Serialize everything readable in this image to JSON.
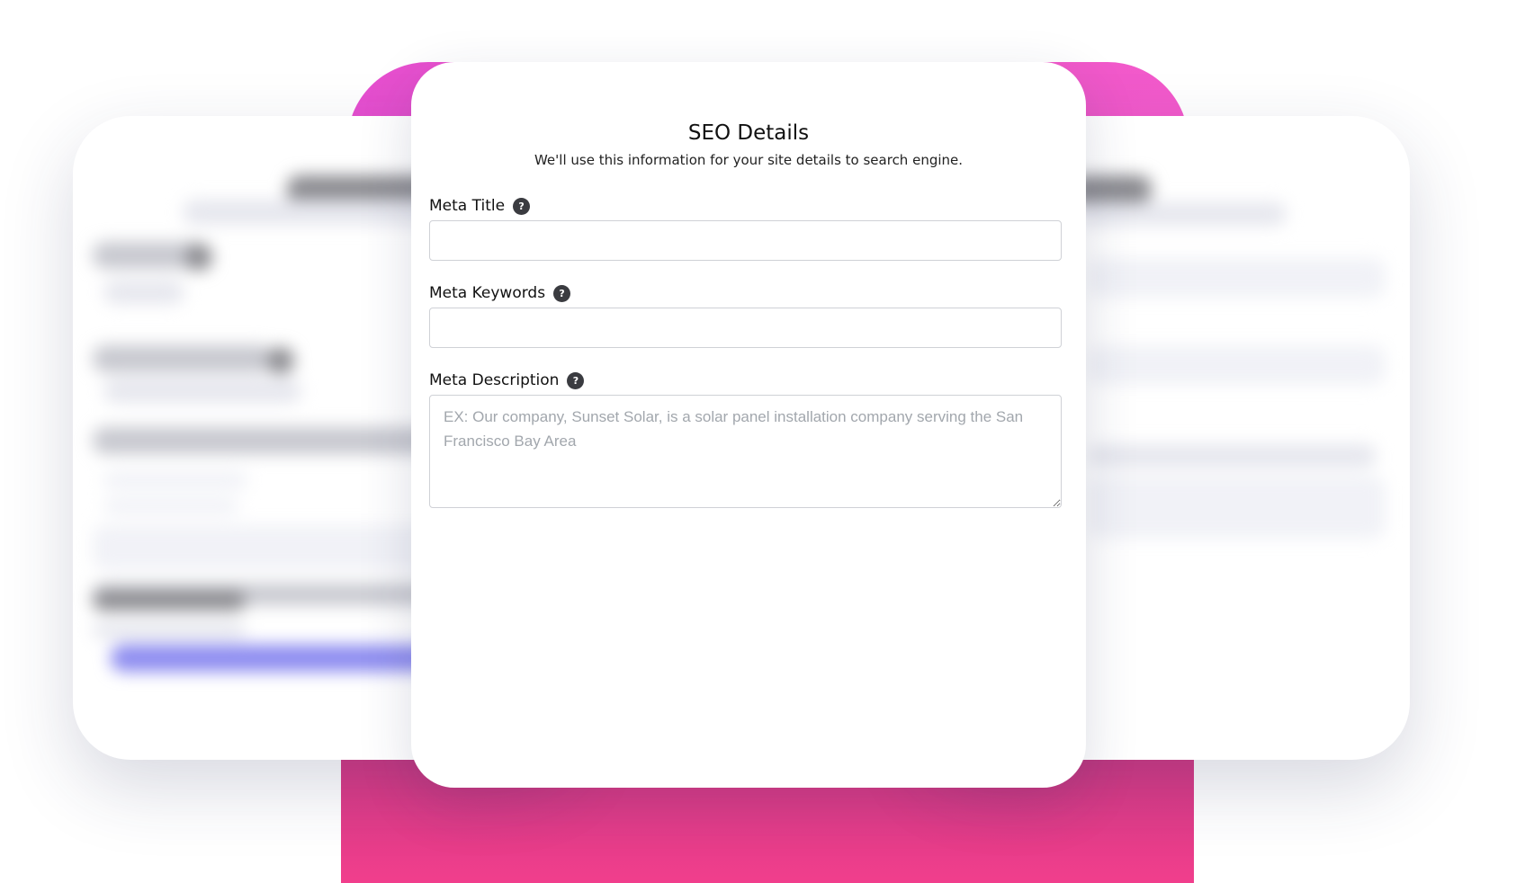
{
  "seo_form": {
    "title": "SEO Details",
    "subtitle": "We'll use this information for your site details to search engine.",
    "help_glyph": "?",
    "fields": {
      "meta_title": {
        "label": "Meta Title",
        "value": "",
        "placeholder": ""
      },
      "meta_keywords": {
        "label": "Meta Keywords",
        "value": "",
        "placeholder": ""
      },
      "meta_description": {
        "label": "Meta Description",
        "value": "",
        "placeholder": "EX: Our company, Sunset Solar, is a solar panel installation company serving the San Francisco Bay Area"
      }
    }
  },
  "theme": {
    "accent_pink": "#ee55c8",
    "accent_magenta": "#f13e8c",
    "help_icon_bg": "#3a3b40",
    "card_bg": "#ffffff"
  },
  "icons": {
    "help": "question-circle-icon"
  }
}
